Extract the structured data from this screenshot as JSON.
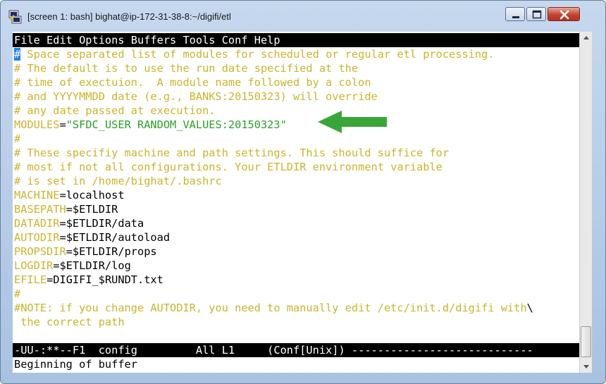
{
  "window": {
    "title": "[screen 1: bash] bighat@ip-172-31-38-8:~/digifi/etl"
  },
  "menu": {
    "text": "File Edit Options Buffers Tools Conf Help"
  },
  "lines": [
    {
      "cursor": "#",
      "text": " Space separated list of modules for scheduled or regular etl processing."
    },
    {
      "text": "# The default is to use the run date specified at the"
    },
    {
      "text": "# time of exectuion.  A module name followed by a colon"
    },
    {
      "text": "# and YYYYMMDD date (e.g., BANKS:20150323) will override"
    },
    {
      "text": "# any date passed at execution."
    },
    {
      "key": "MODULES",
      "eq": "=",
      "str": "\"SFDC_USER RANDOM_VALUES:20150323\""
    },
    {
      "text": "#"
    },
    {
      "text": "# These specifiy machine and path settings. This should suffice for"
    },
    {
      "text": "# most if not all configurations. Your ETLDIR environment variable"
    },
    {
      "text": "# is set in /home/bighat/.bashrc"
    },
    {
      "key": "MACHINE",
      "eq": "=",
      "val": "localhost"
    },
    {
      "key": "BASEPATH",
      "eq": "=",
      "val": "$ETLDIR"
    },
    {
      "key": "DATADIR",
      "eq": "=",
      "val": "$ETLDIR/data"
    },
    {
      "key": "AUTODIR",
      "eq": "=",
      "val": "$ETLDIR/autoload"
    },
    {
      "key": "PROPSDIR",
      "eq": "=",
      "val": "$ETLDIR/props"
    },
    {
      "key": "LOGDIR",
      "eq": "=",
      "val": "$ETLDIR/log"
    },
    {
      "key": "EFILE",
      "eq": "=",
      "val": "DIGIFI_$RUNDT.txt"
    },
    {
      "text": "#"
    },
    {
      "text": "#NOTE: if you change AUTODIR, you need to manually edit /etc/init.d/digifi with",
      "wrap": "\\"
    },
    {
      "text": " the correct path"
    }
  ],
  "mode_line": {
    "text": "-UU-:**--F1  config         All L1     (Conf[Unix]) ----------------------------"
  },
  "echo_area": {
    "text": "Beginning of buffer"
  },
  "icons": {
    "app": "putty-icon",
    "minimize": "minimize-icon",
    "maximize": "maximize-icon",
    "close": "close-icon",
    "annotation": "green-arrow-icon"
  },
  "colors": {
    "comment": "#c9b52c",
    "string": "#2aa02a",
    "cursor": "#1e7fe8",
    "arrow": "#3aa63a"
  }
}
